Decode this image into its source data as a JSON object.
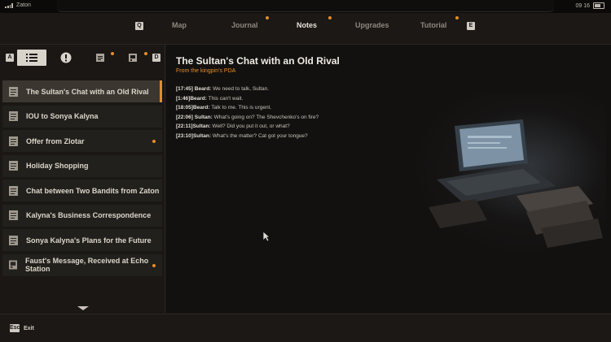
{
  "status": {
    "carrier": "Zaton",
    "time": "09 16"
  },
  "tabs": {
    "left_key": "Q",
    "right_key": "E",
    "items": [
      {
        "label": "Map",
        "active": false,
        "dot": false
      },
      {
        "label": "Journal",
        "active": false,
        "dot": true
      },
      {
        "label": "Notes",
        "active": true,
        "dot": true
      },
      {
        "label": "Upgrades",
        "active": false,
        "dot": false
      },
      {
        "label": "Tutorial",
        "active": false,
        "dot": true
      }
    ]
  },
  "subtabs": {
    "left_key": "A",
    "right_key": "D"
  },
  "notes": [
    {
      "title": "The Sultan's Chat with an Old Rival",
      "selected": true,
      "unread": false
    },
    {
      "title": "IOU to Sonya Kalyna",
      "selected": false,
      "unread": false
    },
    {
      "title": "Offer from Zlotar",
      "selected": false,
      "unread": true
    },
    {
      "title": "Holiday Shopping",
      "selected": false,
      "unread": false
    },
    {
      "title": "Chat between Two Bandits from Zaton",
      "selected": false,
      "unread": false
    },
    {
      "title": "Kalyna's Business Correspondence",
      "selected": false,
      "unread": false
    },
    {
      "title": "Sonya Kalyna's Plans for the Future",
      "selected": false,
      "unread": false
    },
    {
      "title": "Faust's Message, Received at Echo Station",
      "selected": false,
      "unread": true
    }
  ],
  "detail": {
    "title": "The Sultan's Chat with an Old Rival",
    "source": "From the kingpin's PDA",
    "messages": [
      {
        "stamp": "[17:45] Beard:",
        "text": " We need to talk, Sultan."
      },
      {
        "stamp": "[1:46]Beard:",
        "text": " This can't wait."
      },
      {
        "stamp": "[18:05]Beard:",
        "text": " Talk to me. This is urgent."
      },
      {
        "stamp": "[22:06] Sultan:",
        "text": " What's going on? The Shevchenko's on fire?"
      },
      {
        "stamp": "[22:11]Sultan:",
        "text": " Well? Did you put it out, or what?"
      },
      {
        "stamp": "[23:10]Sultan:",
        "text": " What's the matter? Cat got your tongue?"
      }
    ]
  },
  "footer": {
    "key": "Esc",
    "label": "Exit"
  },
  "colors": {
    "accent": "#e38d2a",
    "background": "#161412"
  }
}
